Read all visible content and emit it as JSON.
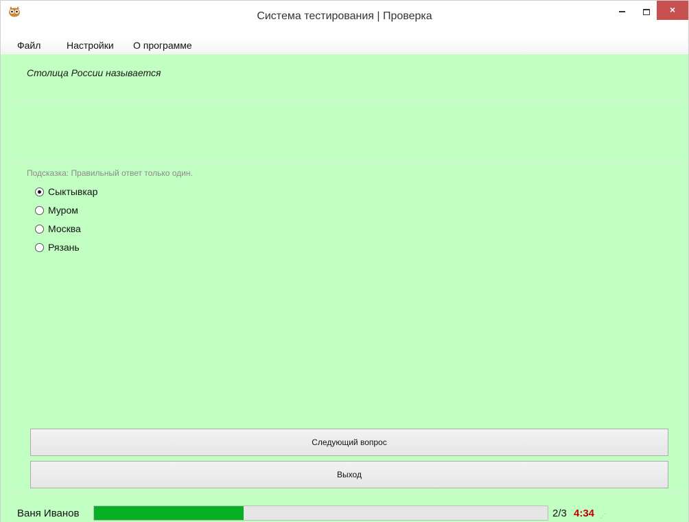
{
  "window": {
    "title": "Система тестирования | Проверка",
    "app_icon": "owl-icon",
    "controls": {
      "minimize": "minimize-icon",
      "maximize": "maximize-icon",
      "close_label": "×"
    }
  },
  "menu": {
    "items": [
      {
        "label": "Файл"
      },
      {
        "label": "Настройки"
      },
      {
        "label": "О программе"
      }
    ]
  },
  "question": {
    "text": "Столица России называется",
    "hint": "Подсказка: Правильный ответ только один."
  },
  "answers": [
    {
      "label": "Сыктывкар",
      "selected": true
    },
    {
      "label": "Муром",
      "selected": false
    },
    {
      "label": "Москва",
      "selected": false
    },
    {
      "label": "Рязань",
      "selected": false
    }
  ],
  "buttons": {
    "next_label": "Следующий вопрос",
    "exit_label": "Выход"
  },
  "status": {
    "user_name": "Ваня Иванов",
    "progress_fraction": 0.33,
    "counter": "2/3",
    "timer": "4:34"
  },
  "colors": {
    "background": "#c2ffc2",
    "progress": "#06b025",
    "timer": "#c00000",
    "close_button": "#c75050"
  }
}
